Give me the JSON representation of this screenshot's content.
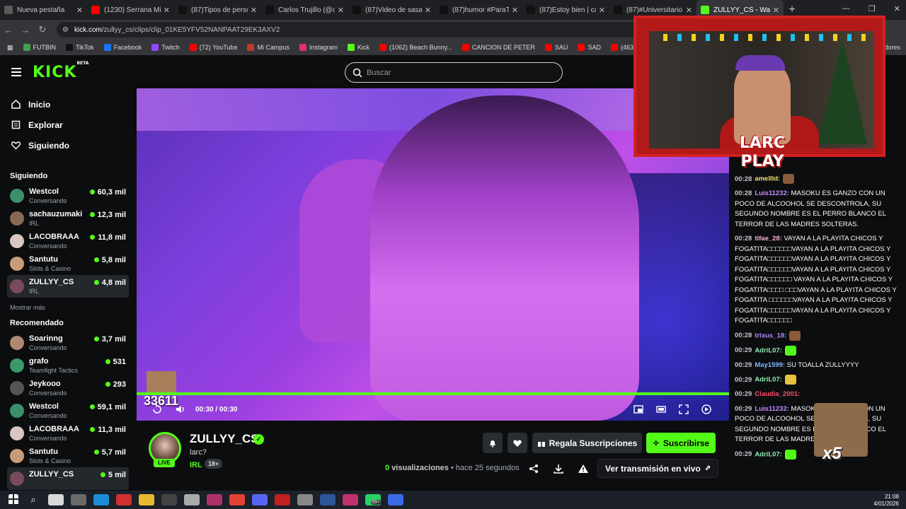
{
  "browser": {
    "tabs": [
      {
        "title": "Nueva pestaña",
        "icon": "chrome-icon",
        "color": "#5a5a5a"
      },
      {
        "title": "(1230) Serrana Mia -",
        "icon": "youtube-icon",
        "color": "#ff0000"
      },
      {
        "title": "(87)Tipos de persona",
        "icon": "tiktok-icon",
        "color": "#111111"
      },
      {
        "title": "Carlos Trujillo (@carlo",
        "icon": "tiktok-icon",
        "color": "#111111"
      },
      {
        "title": "(87)Video de sasaap",
        "icon": "tiktok-icon",
        "color": "#111111"
      },
      {
        "title": "(87)humor #ParaTi #",
        "icon": "tiktok-icon",
        "color": "#111111"
      },
      {
        "title": "(87)Estoy bien | carac",
        "icon": "tiktok-icon",
        "color": "#111111"
      },
      {
        "title": "(87)#Universitario de",
        "icon": "tiktok-icon",
        "color": "#111111"
      },
      {
        "title": "ZULLYY_CS - Watch",
        "icon": "kick-icon",
        "color": "#53fc18"
      }
    ],
    "url_host": "kick.com",
    "url_path": "/zullyy_cs/clips/clip_01KE5YFV52NANPAAT29EK3AXV2",
    "bookmarks": [
      {
        "label": "FUTBIN",
        "color": "#3fa34d"
      },
      {
        "label": "TikTok",
        "color": "#111111"
      },
      {
        "label": "Facebook",
        "color": "#1877f2"
      },
      {
        "label": "Twitch",
        "color": "#9146ff"
      },
      {
        "label": "(72) YouTube",
        "color": "#ff0000"
      },
      {
        "label": "Mi Campus",
        "color": "#c0392b"
      },
      {
        "label": "Instagram",
        "color": "#e1306c"
      },
      {
        "label": "Kick",
        "color": "#53fc18"
      },
      {
        "label": "(1062) Beach Bunny...",
        "color": "#ff0000"
      },
      {
        "label": "CANCION DE PETER",
        "color": "#ff0000"
      },
      {
        "label": "SAU",
        "color": "#ff0000"
      },
      {
        "label": "SAD",
        "color": "#ff0000"
      },
      {
        "label": "(463) James Arthur -...",
        "color": "#ff0000"
      },
      {
        "label": "DRA",
        "color": "#ff0000"
      }
    ],
    "bookmarks_right": "adores"
  },
  "kick": {
    "logo": "KICK",
    "logo_badge": "BETA",
    "search_placeholder": "Buscar",
    "nav": [
      {
        "label": "Inicio"
      },
      {
        "label": "Explorar"
      },
      {
        "label": "Siguiendo"
      }
    ],
    "following_title": "Siguiendo",
    "following": [
      {
        "name": "Westcol",
        "category": "Conversando",
        "viewers": "60,3 mil",
        "color": "#3b8f6b"
      },
      {
        "name": "sachauzumaki",
        "category": "IRL",
        "viewers": "12,3 mil",
        "color": "#8a6a55"
      },
      {
        "name": "LACOBRAAA",
        "category": "Conversando",
        "viewers": "11,8 mil",
        "color": "#d8c6c0"
      },
      {
        "name": "Santutu",
        "category": "Slots & Casino",
        "viewers": "5,8 mil",
        "color": "#c89c78"
      },
      {
        "name": "ZULLYY_CS",
        "category": "IRL",
        "viewers": "4,8 mil",
        "color": "#7a4a5a"
      }
    ],
    "show_more": "Mostrar más",
    "recommended_title": "Recomendado",
    "recommended": [
      {
        "name": "Soarinng",
        "category": "Conversando",
        "viewers": "3,7 mil",
        "color": "#b08870"
      },
      {
        "name": "grafo",
        "category": "Teamfight Tactics",
        "viewers": "531",
        "color": "#3a9a6a"
      },
      {
        "name": "Jeykooo",
        "category": "Conversando",
        "viewers": "293",
        "color": "#555555"
      },
      {
        "name": "Westcol",
        "category": "Conversando",
        "viewers": "59,1 mil",
        "color": "#3b8f6b"
      },
      {
        "name": "LACOBRAAA",
        "category": "Conversando",
        "viewers": "11,3 mil",
        "color": "#d8c6c0"
      },
      {
        "name": "Santutu",
        "category": "Slots & Casino",
        "viewers": "5,7 mil",
        "color": "#c89c78"
      },
      {
        "name": "ZULLYY_CS",
        "category": "",
        "viewers": "5 mil",
        "color": "#7a4a5a"
      }
    ],
    "player": {
      "time": "00:30 / 00:30",
      "overlay_counter": "33611",
      "progress": 1.0
    },
    "clip": {
      "channel": "ZULLYY_CS",
      "title": "larc?",
      "category": "IRL",
      "badge": "18+",
      "live_badge": "LIVE",
      "views_count": "0",
      "views_label": "visualizaciones",
      "ago": "• hace 25 segundos",
      "gift_label": "Regala Suscripciones",
      "subscribe_label": "Suscribirse",
      "watch_live_label": "Ver transmisión en vivo"
    },
    "overlay_text": "LARC PLAY",
    "chat": [
      {
        "time": "00:28",
        "user": "amellld:",
        "color": "#f5e36b",
        "text": "",
        "emote": "#8a5a3a"
      },
      {
        "time": "00:28",
        "user": "Luis11232:",
        "color": "#c58bff",
        "text": "MASOKU ES GANZO CON UN POCO DE ALCOOHOL SE DESCONTROLA, SU SEGUNDO NOMBRE ES EL PERRO BLANCO EL TERROR DE LAS MADRES SOLTERAS."
      },
      {
        "time": "00:28",
        "user": "tifae_28:",
        "color": "#ffb0d0",
        "text": "VAYAN A LA PLAYITA CHICOS Y FOGATITA□□□□□□VAYAN A LA PLAYITA CHICOS Y FOGATITA□□□□□□VAYAN A LA PLAYITA CHICOS Y FOGATITA□□□□□□VAYAN A LA PLAYITA CHICOS Y FOGATITA□□□□□□ VAYAN A LA PLAYITA CHICOS Y FOGATITA□□□□ □□□VAYAN A LA PLAYITA CHICOS Y FOGATITA □□□□□□VAYAN A LA PLAYITA CHICOS Y FOGATITA□□□□□□VAYAN A LA PLAYITA CHICOS Y FOGATITA□□□□□□"
      },
      {
        "time": "00:28",
        "user": "trixus_18:",
        "color": "#b38cff",
        "text": "",
        "emote": "#8a5a3a"
      },
      {
        "time": "00:29",
        "user": "AdriL07:",
        "color": "#8ff0b0",
        "text": "",
        "emote": "#53fc18"
      },
      {
        "time": "00:29",
        "user": "May1599:",
        "color": "#7fb6ff",
        "text": "SU TOALLA ZULLYYYY"
      },
      {
        "time": "00:29",
        "user": "AdriL07:",
        "color": "#8ff0b0",
        "text": "",
        "emote": "#e8c040"
      },
      {
        "time": "00:29",
        "user": "Claudia_2001:",
        "color": "#ff4d6d",
        "text": ""
      },
      {
        "time": "00:29",
        "user": "Luis11232:",
        "color": "#c58bff",
        "text": "MASOKU ES GANZO CON UN POCO DE ALCOOHOL SE DESCONTROLA, SU SEGUNDO NOMBRE ES EL PERRO BLANCO EL TERROR DE LAS MADRES SOLTERAS."
      },
      {
        "time": "00:29",
        "user": "AdriL07:",
        "color": "#8ff0b0",
        "text": "",
        "emote": "#53fc18"
      }
    ],
    "chat_meme_label": "x5"
  },
  "system": {
    "time": "21:08",
    "date": "4/01/2026",
    "notif": "99+"
  }
}
